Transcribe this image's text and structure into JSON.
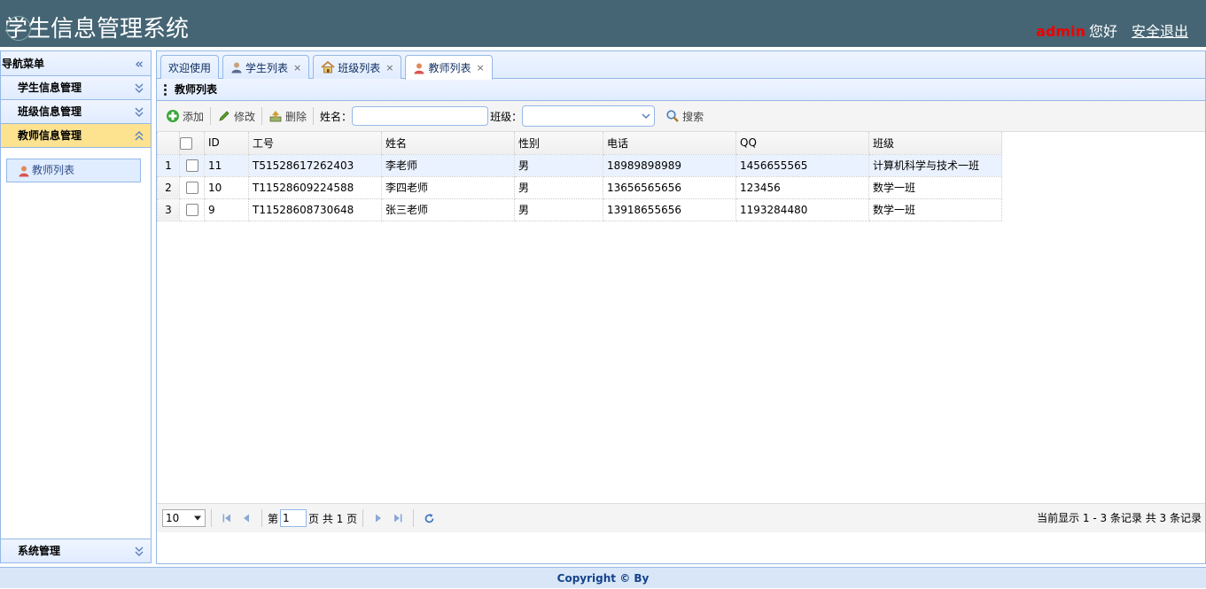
{
  "header": {
    "title": "学生信息管理系统",
    "admin_name": "admin",
    "greeting": "您好",
    "logout_label": "安全退出"
  },
  "nav": {
    "title": "导航菜单",
    "groups": [
      {
        "label": "学生信息管理"
      },
      {
        "label": "班级信息管理"
      },
      {
        "label": "教师信息管理"
      }
    ],
    "active_item": "教师列表",
    "bottom_group": "系统管理"
  },
  "tabs": [
    {
      "label": "欢迎使用"
    },
    {
      "label": "学生列表"
    },
    {
      "label": "班级列表"
    },
    {
      "label": "教师列表"
    }
  ],
  "panel": {
    "title": "教师列表"
  },
  "toolbar": {
    "add_label": "添加",
    "edit_label": "修改",
    "delete_label": "删除",
    "name_label": "姓名：",
    "class_label": "班级：",
    "search_label": "搜索",
    "name_value": "",
    "class_value": ""
  },
  "grid": {
    "columns": [
      "ID",
      "工号",
      "姓名",
      "性别",
      "电话",
      "QQ",
      "班级"
    ],
    "rows": [
      {
        "no": "1",
        "id": "11",
        "code": "T51528617262403",
        "name": "李老师",
        "gender": "男",
        "phone": "18989898989",
        "qq": "1456655565",
        "class": "计算机科学与技术一班"
      },
      {
        "no": "2",
        "id": "10",
        "code": "T11528609224588",
        "name": "李四老师",
        "gender": "男",
        "phone": "13656565656",
        "qq": "123456",
        "class": "数学一班"
      },
      {
        "no": "3",
        "id": "9",
        "code": "T11528608730648",
        "name": "张三老师",
        "gender": "男",
        "phone": "13918655656",
        "qq": "1193284480",
        "class": "数学一班"
      }
    ]
  },
  "pager": {
    "page_size": "10",
    "page_prefix": "第",
    "page_value": "1",
    "page_suffix": "页 共 1 页",
    "info": "当前显示 1 - 3 条记录 共 3 条记录"
  },
  "footer": {
    "copyright": "Copyright © By"
  },
  "colors": {
    "header": "#456574",
    "accent": "#95b8e7",
    "active_group": "#fde28f",
    "admin": "#ee0000"
  }
}
